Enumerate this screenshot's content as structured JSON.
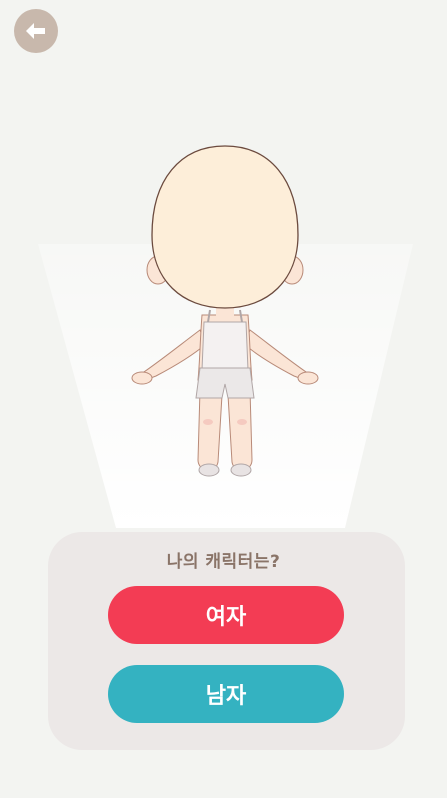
{
  "header": {
    "back_icon": "arrow-left-icon"
  },
  "prompt": {
    "question": "나의 캐릭터는?"
  },
  "options": {
    "female_label": "여자",
    "male_label": "남자"
  },
  "colors": {
    "background": "#f3f4f1",
    "panel": "#ece8e7",
    "female_button": "#f33c54",
    "male_button": "#34b2c1",
    "back_button": "#c8b8ac",
    "question_text": "#8a7468"
  }
}
